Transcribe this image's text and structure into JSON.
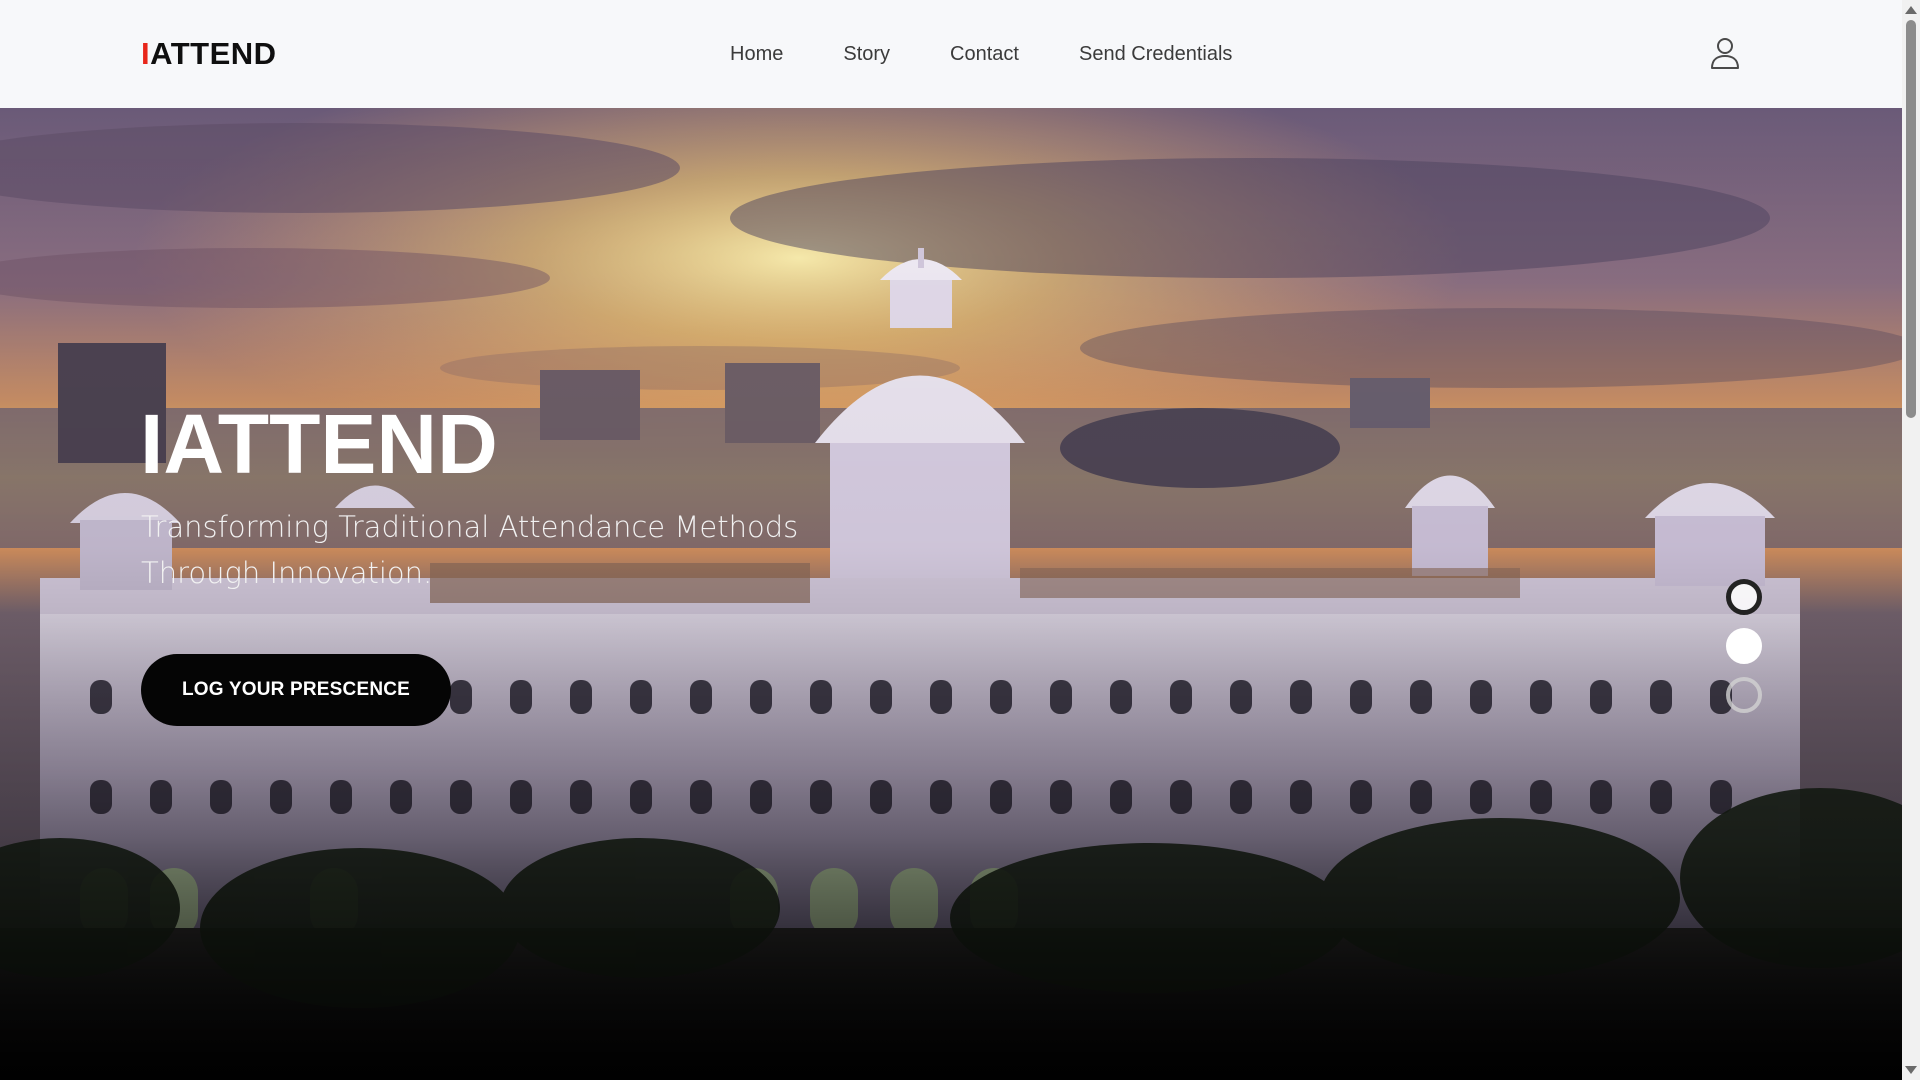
{
  "brand": {
    "logo_accent": "I",
    "logo_rest": "ATTEND",
    "accent_color": "#e8261a"
  },
  "nav": {
    "links": [
      {
        "label": "Home"
      },
      {
        "label": "Story"
      },
      {
        "label": "Contact"
      },
      {
        "label": "Send Credentials"
      }
    ],
    "user_icon": "user-icon"
  },
  "hero": {
    "title": "IATTEND",
    "subtitle": "Transforming Traditional Attendance Methods Through Innovation.",
    "cta_label": "LOG YOUR PRESCENCE",
    "background": "photo of a white domed campus building at sunset",
    "carousel": {
      "slide_count": 3,
      "active_index": 1
    }
  },
  "scrollbar": {
    "up_icon": "triangle-up-icon",
    "down_icon": "triangle-down-icon"
  }
}
